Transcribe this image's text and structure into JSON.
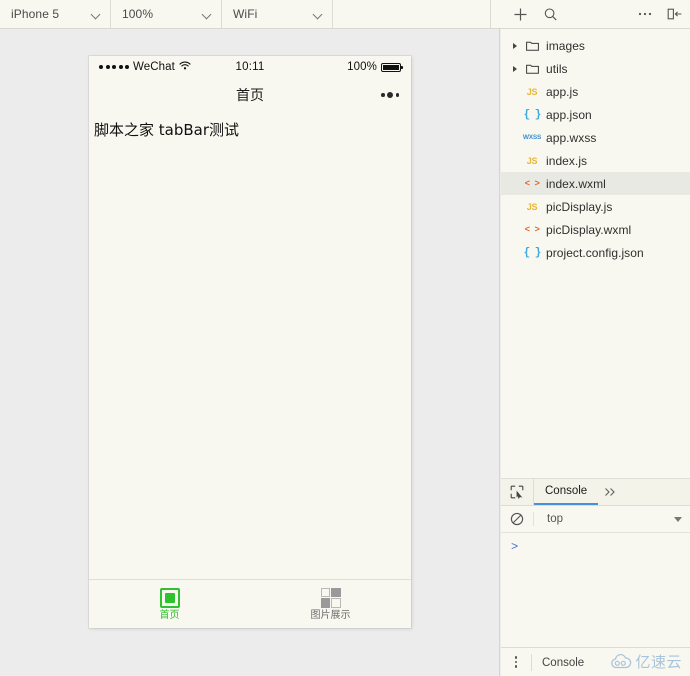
{
  "toolbar": {
    "device": {
      "value": "iPhone 5",
      "icon": "chevron-down-icon"
    },
    "zoom": {
      "value": "100%",
      "icon": "chevron-down-icon"
    },
    "network": {
      "value": "WiFi",
      "icon": "chevron-down-icon"
    },
    "icons": {
      "add": "plus-icon",
      "search": "search-icon",
      "more": "ellipsis-icon",
      "collapse": "collapse-panel-icon"
    }
  },
  "simulator": {
    "statusbar": {
      "carrier": "WeChat",
      "signal_dots": 5,
      "wifi_icon": "wifi-icon",
      "time": "10:11",
      "battery_percent": "100%",
      "battery_icon": "battery-full-icon"
    },
    "navbar": {
      "title": "首页",
      "menu_icon": "wechat-capsule-menu-icon"
    },
    "page": {
      "text": "脚本之家 tabBar测试"
    },
    "tabbar": {
      "active_color": "#2ec22e",
      "inactive_color": "#6b6b6b",
      "items": [
        {
          "label": "首页",
          "icon": "chip-square-icon",
          "active": true
        },
        {
          "label": "图片展示",
          "icon": "grid-four-squares-icon",
          "active": false
        }
      ]
    }
  },
  "filetree": {
    "items": [
      {
        "name": "images",
        "type": "folder",
        "icon": "folder-icon",
        "expandable": true,
        "selected": false
      },
      {
        "name": "utils",
        "type": "folder",
        "icon": "folder-icon",
        "expandable": true,
        "selected": false
      },
      {
        "name": "app.js",
        "type": "js",
        "icon": "js-file-icon",
        "expandable": false,
        "selected": false
      },
      {
        "name": "app.json",
        "type": "json",
        "icon": "json-file-icon",
        "expandable": false,
        "selected": false
      },
      {
        "name": "app.wxss",
        "type": "wxss",
        "icon": "wxss-file-icon",
        "expandable": false,
        "selected": false
      },
      {
        "name": "index.js",
        "type": "js",
        "icon": "js-file-icon",
        "expandable": false,
        "selected": false
      },
      {
        "name": "index.wxml",
        "type": "wxml",
        "icon": "wxml-file-icon",
        "expandable": false,
        "selected": true
      },
      {
        "name": "picDisplay.js",
        "type": "js",
        "icon": "js-file-icon",
        "expandable": false,
        "selected": false
      },
      {
        "name": "picDisplay.wxml",
        "type": "wxml",
        "icon": "wxml-file-icon",
        "expandable": false,
        "selected": false
      },
      {
        "name": "project.config.json",
        "type": "json",
        "icon": "json-file-icon",
        "expandable": false,
        "selected": false
      }
    ]
  },
  "console": {
    "inspect_icon": "inspect-element-icon",
    "tabs": [
      {
        "label": "Console",
        "active": true
      }
    ],
    "more_tabs_icon": "chevron-double-right-icon",
    "clear_icon": "clear-console-icon",
    "context": "top",
    "context_caret_icon": "caret-down-icon",
    "prompt": ">",
    "active_underline_color": "#4a90d9"
  },
  "statusline": {
    "menu_icon": "vertical-dots-icon",
    "label": "Console"
  },
  "watermark": {
    "logo_icon": "cloud-logo-icon",
    "text": "亿速云",
    "color": "#a8c4dc"
  }
}
